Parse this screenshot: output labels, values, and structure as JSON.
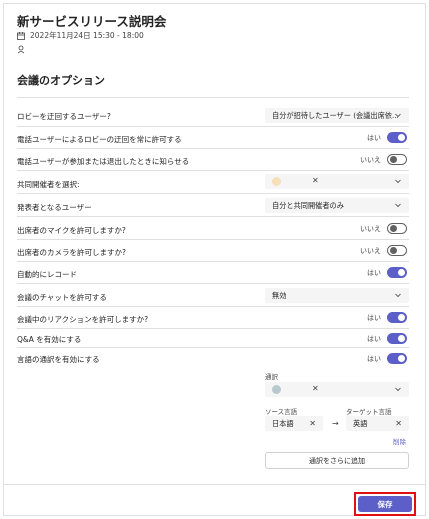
{
  "meeting": {
    "title": "新サービスリリース説明会",
    "datetime": "2022年11月24日 15:30 - 18:00"
  },
  "options_heading": "会議のオプション",
  "rows": {
    "lobby_bypass": {
      "label": "ロビーを迂回するユーザー?",
      "value": "自分が招待したユーザー (会議出席依..."
    },
    "dialin_bypass": {
      "label": "電話ユーザーによるロビーの迂回を常に許可する",
      "state": "はい"
    },
    "dialin_notify": {
      "label": "電話ユーザーが参加または退出したときに知らせる",
      "state": "いいえ"
    },
    "coorganizers": {
      "label": "共同開催者を選択:"
    },
    "presenters": {
      "label": "発表者となるユーザー",
      "value": "自分と共同開催者のみ"
    },
    "mic": {
      "label": "出席者のマイクを許可しますか?",
      "state": "いいえ"
    },
    "camera": {
      "label": "出席者のカメラを許可しますか?",
      "state": "いいえ"
    },
    "autorecord": {
      "label": "自動的にレコード",
      "state": "はい"
    },
    "chat": {
      "label": "会議のチャットを許可する",
      "value": "無効"
    },
    "reactions": {
      "label": "会議中のリアクションを許可しますか?",
      "state": "はい"
    },
    "qa": {
      "label": "Q&A を有効にする",
      "state": "はい"
    },
    "interpretation": {
      "label": "言語の通訳を有効にする",
      "state": "はい"
    }
  },
  "interpretation": {
    "interpreter_label": "通訳",
    "source_label": "ソース言語",
    "target_label": "ターゲット言語",
    "source_value": "日本語",
    "target_value": "英語",
    "arrow": "→",
    "remove_link": "削除",
    "add_button": "通訳をさらに追加"
  },
  "save_button": "保存",
  "colors": {
    "accent": "#5b5fc7",
    "highlight": "#e01010"
  }
}
